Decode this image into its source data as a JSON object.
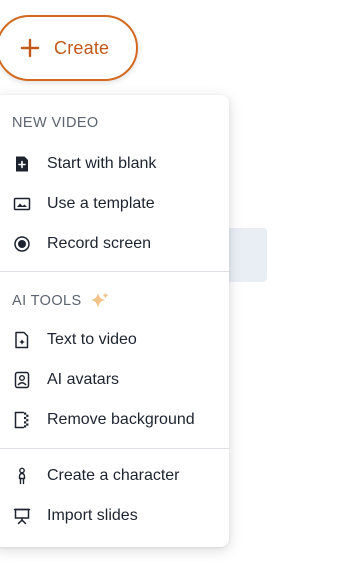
{
  "create_button": {
    "label": "Create",
    "icon": "plus-icon",
    "accent_color": "#c2581a"
  },
  "menu": {
    "new_video": {
      "title": "NEW VIDEO",
      "items": [
        {
          "label": "Start with blank",
          "icon": "new-file-icon"
        },
        {
          "label": "Use a template",
          "icon": "image-template-icon"
        },
        {
          "label": "Record screen",
          "icon": "record-icon"
        }
      ]
    },
    "ai_tools": {
      "title": "AI TOOLS",
      "title_icon": "sparkle-icon",
      "items": [
        {
          "label": "Text to video",
          "icon": "text-to-video-icon"
        },
        {
          "label": "AI avatars",
          "icon": "avatar-icon"
        },
        {
          "label": "Remove background",
          "icon": "remove-background-icon"
        }
      ]
    },
    "other": {
      "items": [
        {
          "label": "Create a character",
          "icon": "character-icon"
        },
        {
          "label": "Import slides",
          "icon": "presentation-icon"
        }
      ]
    }
  }
}
